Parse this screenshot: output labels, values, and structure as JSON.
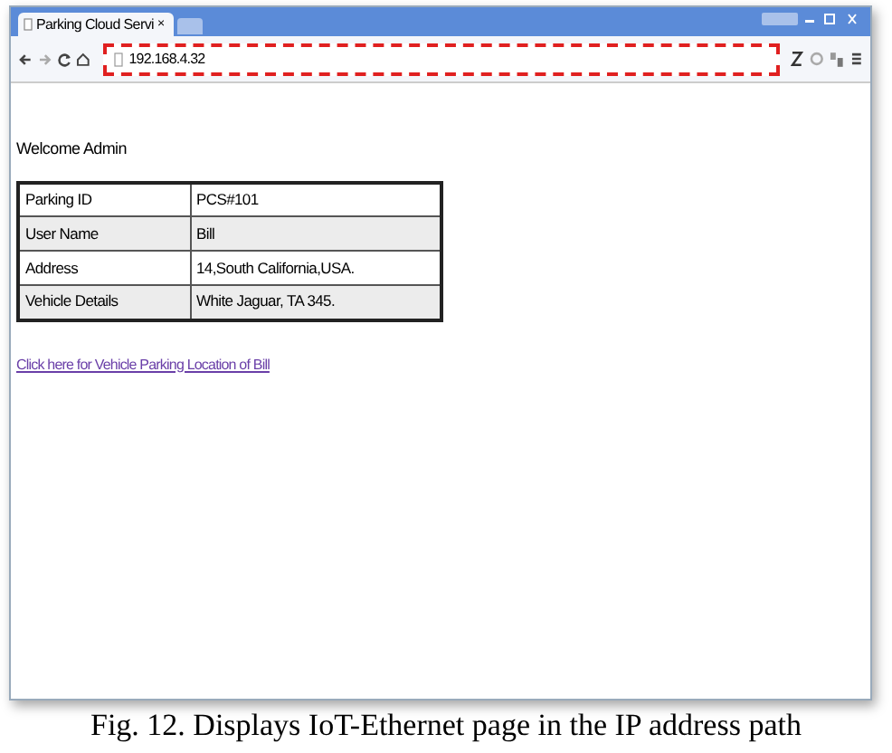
{
  "browser": {
    "tab": {
      "title": "Parking Cloud Servi",
      "close": "×",
      "selected": true
    },
    "address": "192.168.4.32"
  },
  "page": {
    "welcome": "Welcome Admin",
    "table": {
      "rows": [
        {
          "label": "Parking ID",
          "value": "PCS#101",
          "shaded": false
        },
        {
          "label": "User Name",
          "value": "Bill",
          "shaded": true
        },
        {
          "label": "Address",
          "value": "14,South California,USA.",
          "shaded": false
        },
        {
          "label": "Vehicle Details",
          "value": "White Jaguar, TA 345.",
          "shaded": true
        }
      ]
    },
    "link": "Click here for Vehicle Parking Location of Bill"
  },
  "caption": "Fig. 12. Displays IoT-Ethernet page in the IP address path"
}
